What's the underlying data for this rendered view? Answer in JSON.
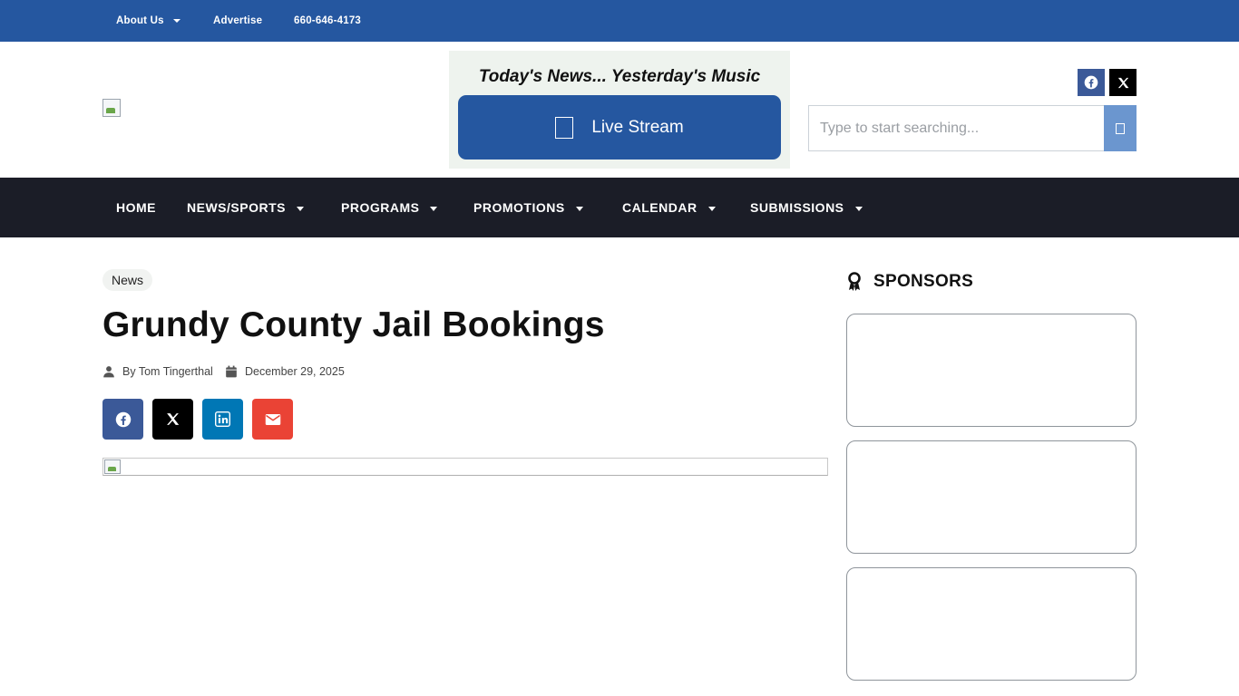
{
  "topbar": {
    "about": "About Us",
    "advertise": "Advertise",
    "phone": "660-646-4173"
  },
  "header": {
    "logo_icon": "broken-image-icon",
    "tagline": "Today's News... Yesterday's Music",
    "live_stream_label": "Live Stream",
    "social": [
      "facebook-icon",
      "x-icon"
    ],
    "search": {
      "placeholder": "Type to start searching..."
    }
  },
  "nav": {
    "items": [
      {
        "label": "HOME",
        "has_dropdown": false
      },
      {
        "label": "NEWS/SPORTS",
        "has_dropdown": true
      },
      {
        "label": "PROGRAMS",
        "has_dropdown": true
      },
      {
        "label": "PROMOTIONS",
        "has_dropdown": true
      },
      {
        "label": "CALENDAR",
        "has_dropdown": true
      },
      {
        "label": "SUBMISSIONS",
        "has_dropdown": true
      }
    ]
  },
  "article": {
    "category": "News",
    "title": "Grundy County Jail Bookings",
    "author": "By Tom Tingerthal",
    "date": "December 29, 2025",
    "share": [
      {
        "network": "facebook",
        "icon": "facebook-icon",
        "color": "#3b5998"
      },
      {
        "network": "x",
        "icon": "x-icon",
        "color": "#000000"
      },
      {
        "network": "linkedin",
        "icon": "linkedin-icon",
        "color": "#0077b5"
      },
      {
        "network": "email",
        "icon": "envelope-icon",
        "color": "#ea4335"
      }
    ]
  },
  "sidebar": {
    "heading": "SPONSORS",
    "heading_icon": "award-ribbon-icon",
    "cards": 3
  },
  "colors": {
    "brand_blue": "#2557a0",
    "nav_dark": "#1b1d27",
    "search_button": "#6b96cf",
    "promo_bg": "#eef3ee"
  }
}
